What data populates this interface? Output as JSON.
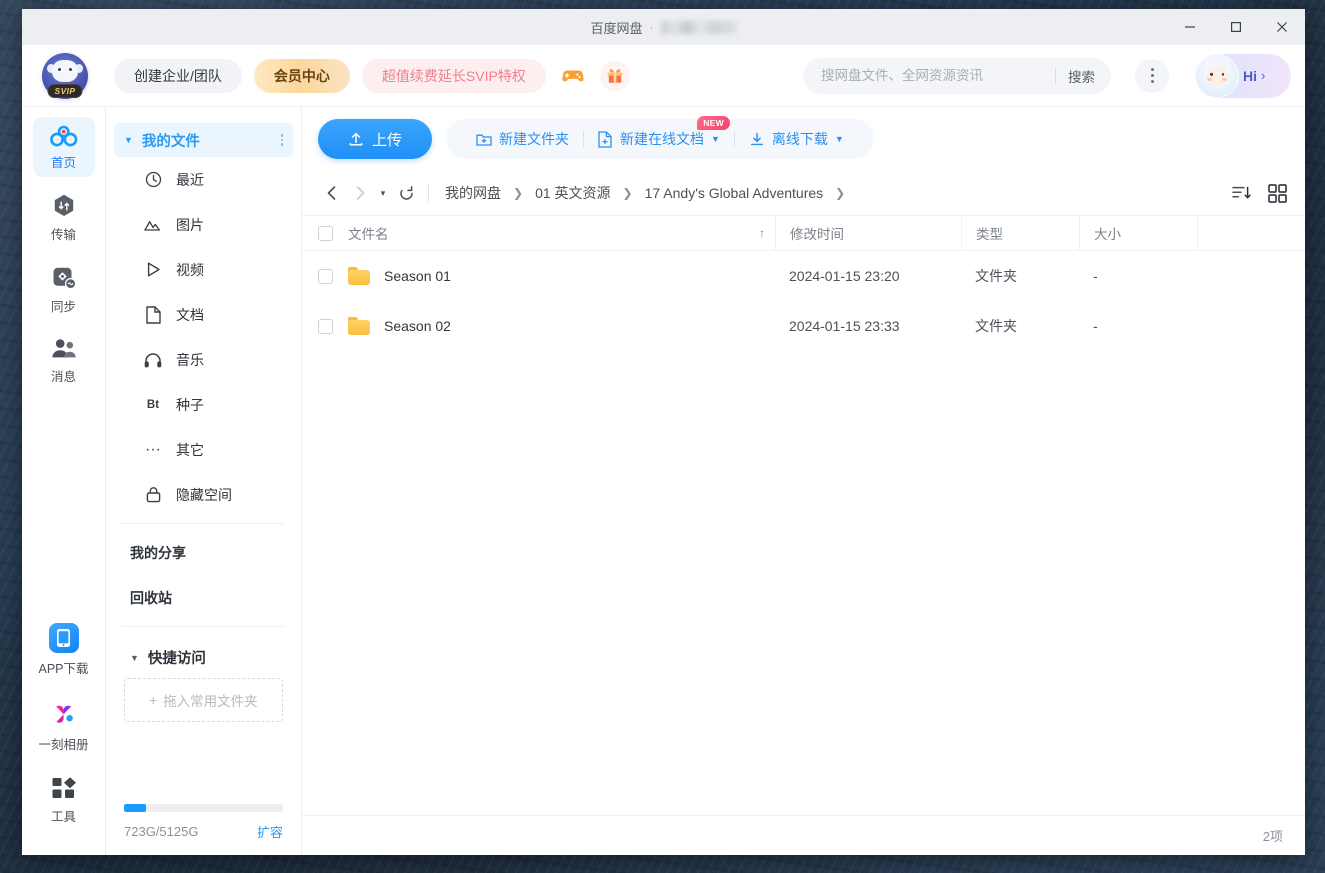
{
  "window": {
    "title": "百度网盘",
    "title_separator": "·",
    "minimize_label": "最小化",
    "maximize_label": "最大化",
    "close_label": "关闭"
  },
  "topnav": {
    "brand_badge": "SVIP",
    "create_team": "创建企业/团队",
    "vip_center": "会员中心",
    "svip_promo": "超值续费延长SVIP特权",
    "game_icon": "gamepad-icon",
    "gift_icon": "gift-icon",
    "search": {
      "placeholder": "搜网盘文件、全网资源资讯",
      "value": "",
      "button": "搜索"
    },
    "more": "更多",
    "user_greeting": "Hi",
    "user_arrow": "›"
  },
  "rail": {
    "items": [
      {
        "label": "首页",
        "icon": "home-cloud-icon",
        "active": true
      },
      {
        "label": "传输",
        "icon": "transfer-icon",
        "active": false
      },
      {
        "label": "同步",
        "icon": "sync-icon",
        "active": false
      },
      {
        "label": "消息",
        "icon": "message-people-icon",
        "active": false
      }
    ],
    "bottom_items": [
      {
        "label": "APP下载",
        "icon": "phone-app-icon"
      },
      {
        "label": "一刻相册",
        "icon": "album-icon"
      },
      {
        "label": "工具",
        "icon": "tools-grid-icon"
      }
    ]
  },
  "tree": {
    "header": {
      "label": "我的文件",
      "caret": "▼",
      "menu": "kebab-menu"
    },
    "items": [
      {
        "label": "最近",
        "icon": "clock-icon"
      },
      {
        "label": "图片",
        "icon": "image-icon"
      },
      {
        "label": "视频",
        "icon": "play-icon"
      },
      {
        "label": "文档",
        "icon": "document-icon"
      },
      {
        "label": "音乐",
        "icon": "headphone-icon"
      },
      {
        "label": "种子",
        "icon": "bt-icon"
      },
      {
        "label": "其它",
        "icon": "ellipsis-icon"
      },
      {
        "label": "隐藏空间",
        "icon": "lock-icon"
      }
    ],
    "plain_items": [
      {
        "label": "我的分享"
      },
      {
        "label": "回收站"
      }
    ],
    "quick_access": {
      "title": "快捷访问",
      "caret": "▼",
      "dropzone_plus": "+",
      "dropzone_label": "拖入常用文件夹"
    },
    "storage": {
      "used_total": "723G/5125G",
      "expand_link": "扩容",
      "percent": 14
    }
  },
  "toolbar": {
    "upload": "上传",
    "upload_icon": "upload-icon",
    "new_folder": "新建文件夹",
    "new_folder_icon": "folder-plus-icon",
    "new_doc": "新建在线文档",
    "new_doc_icon": "doc-plus-icon",
    "new_doc_badge": "NEW",
    "offline_download": "离线下载",
    "offline_download_icon": "download-icon",
    "caret": "▼"
  },
  "breadcrumb": {
    "back_icon": "chevron-left-icon",
    "forward_icon": "chevron-right-icon",
    "history_caret": "▾",
    "refresh_icon": "refresh-icon",
    "items": [
      "我的网盘",
      "01 英文资源",
      "17 Andy's Global Adventures"
    ],
    "separator": "❯",
    "trailing_separator": "❯",
    "sort_icon": "sort-list-icon",
    "grid_icon": "grid-view-icon"
  },
  "table": {
    "columns": [
      "文件名",
      "修改时间",
      "类型",
      "大小"
    ],
    "sort_indicator": "↑",
    "rows": [
      {
        "name": "Season 01",
        "modified": "2024-01-15 23:20",
        "type": "文件夹",
        "size": "-",
        "icon": "folder-icon",
        "checked": false
      },
      {
        "name": "Season 02",
        "modified": "2024-01-15 23:33",
        "type": "文件夹",
        "size": "-",
        "icon": "folder-icon",
        "checked": false
      }
    ]
  },
  "statusbar": {
    "count": "2项"
  },
  "colors": {
    "accent": "#2a9bf0",
    "upload_blue": "#1f8ef7",
    "folder_yellow": "#f9c03f",
    "vip_gold": "#fbd79b",
    "svip_pink": "#f0808d",
    "new_badge": "#f6426a"
  }
}
